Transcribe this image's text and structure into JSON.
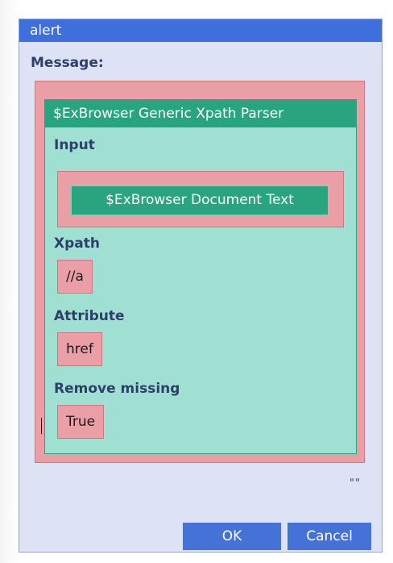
{
  "dialog": {
    "title": "alert",
    "message_label": "Message:",
    "ellipsis": "\"\"",
    "ok_label": "OK",
    "cancel_label": "Cancel"
  },
  "parser": {
    "header": "$ExBrowser Generic Xpath Parser",
    "input_label": "Input",
    "input_value": "$ExBrowser Document Text",
    "xpath_label": "Xpath",
    "xpath_value": "//a",
    "attribute_label": "Attribute",
    "attribute_value": "href",
    "remove_missing_label": "Remove missing",
    "remove_missing_value": "True"
  },
  "colors": {
    "titlebar": "#3f6fdd",
    "dialog_bg": "#dde3f4",
    "pink_block": "#ea9ea5",
    "teal_block": "#9fe0d2",
    "teal_header": "#28a57e",
    "button": "#4472d6",
    "label_text": "#2e3f6b"
  }
}
